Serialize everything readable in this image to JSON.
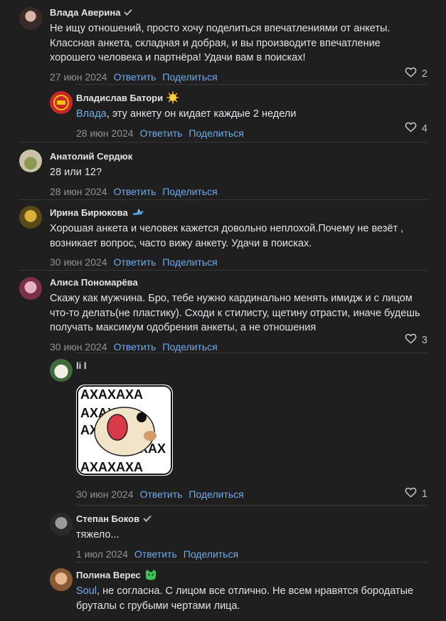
{
  "actions": {
    "reply": "Ответить",
    "share": "Поделиться"
  },
  "comments": [
    {
      "author": "Влада Аверина",
      "badge": "verified-check",
      "text": "Не ищу отношений, просто хочу поделиться впечатлениями от анкеты. Классная анкета, складная и добрая, и вы производите впечатление хорошего человека и партнёра! Удачи вам в поисках!",
      "date": "27 июн 2024",
      "likes": "2"
    },
    {
      "author": "Владислав Батори",
      "badge": "sun-emoji",
      "mention": "Влада",
      "text": ", эту анкету он кидает каждые 2 недели",
      "date": "28 июн 2024",
      "likes": "4"
    },
    {
      "author": "Анатолий Сердюк",
      "text": "28 или 12?",
      "date": "28 июн 2024"
    },
    {
      "author": "Ирина Бирюкова",
      "badge": "ship-emoji",
      "text": "Хорошая анкета и человек кажется довольно неплохой.Почему не везёт , возникает вопрос, часто вижу анкету. Удачи в поисках.",
      "date": "30 июн 2024"
    },
    {
      "author": "Алиса Пономарёва",
      "text": "Скажу как мужчина. Бро, тебе нужно кардинально менять имидж и с лицом что-то делать(не пластику). Сходи к стилисту, щетину отрасти, иначе будешь получать максимум одобрения анкеты, а не отношения",
      "date": "30 июн 2024",
      "likes": "3"
    },
    {
      "author": "li l",
      "sticker_text": [
        "АХАХАХА",
        "АХАХАХА",
        "АХАХ",
        "АХАХ",
        "АХАХ",
        "АХАХ",
        "АХАХ",
        "АХАХАХА"
      ],
      "date": "30 июн 2024",
      "likes": "1"
    },
    {
      "author": "Степан Боков",
      "badge": "verified-check",
      "text": "тяжело...",
      "date": "1 июл 2024"
    },
    {
      "author": "Полина Верес",
      "badge": "green-cat-emoji",
      "mention": "Soul",
      "text": ", не согласна. С лицом все отлично. Не всем нравятся бородатые бруталы с грубыми чертами лица."
    }
  ],
  "colors": {
    "background": "#1f1f1f",
    "link": "#71aaeb",
    "muted": "#939393",
    "text": "#e1e3e6"
  }
}
